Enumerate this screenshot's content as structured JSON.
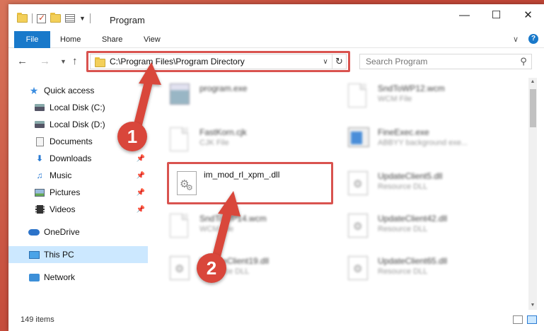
{
  "window": {
    "title": "Program",
    "controls": {
      "minimize": "—",
      "maximize": "☐",
      "close": "✕"
    }
  },
  "ribbon": {
    "tabs": [
      {
        "label": "File",
        "active": true
      },
      {
        "label": "Home"
      },
      {
        "label": "Share"
      },
      {
        "label": "View"
      }
    ],
    "expand": "∨",
    "help": "?"
  },
  "address": {
    "path": "C:\\Program Files\\Program Directory",
    "drop": "∨",
    "refresh": "↻"
  },
  "search": {
    "placeholder": "Search Program"
  },
  "sidebar": {
    "items": [
      {
        "label": "Quick access",
        "icon": "star-icon"
      },
      {
        "label": "Local Disk (C:)",
        "icon": "drive-icon"
      },
      {
        "label": "Local Disk (D:)",
        "icon": "drive-icon"
      },
      {
        "label": "Documents",
        "icon": "document-icon"
      },
      {
        "label": "Downloads",
        "icon": "download-icon",
        "pinned": true
      },
      {
        "label": "Music",
        "icon": "music-icon",
        "pinned": true
      },
      {
        "label": "Pictures",
        "icon": "pictures-icon",
        "pinned": true
      },
      {
        "label": "Videos",
        "icon": "video-icon",
        "pinned": true
      },
      {
        "label": "OneDrive",
        "icon": "cloud-icon"
      },
      {
        "label": "This PC",
        "icon": "computer-icon",
        "selected": true
      },
      {
        "label": "Network",
        "icon": "network-icon"
      }
    ]
  },
  "files": [
    {
      "name": "program.exe",
      "type": "",
      "icon": "exe-icon"
    },
    {
      "name": "SndToWP12.wcm",
      "type": "WCM File",
      "icon": "file-icon"
    },
    {
      "name": "FastKorn.cjk",
      "type": "CJK File",
      "icon": "file-icon"
    },
    {
      "name": "FineExec.exe",
      "type": "ABBYY background exe...",
      "icon": "app-icon"
    },
    {
      "name": "im_mod_rl_xpm_.dll",
      "type": "",
      "icon": "dll-icon"
    },
    {
      "name": "UpdateClient5.dll",
      "type": "Resource DLL",
      "icon": "dll-icon"
    },
    {
      "name": "SndToWP14.wcm",
      "type": "WCM File",
      "icon": "file-icon"
    },
    {
      "name": "UpdateClient42.dll",
      "type": "Resource DLL",
      "icon": "dll-icon"
    },
    {
      "name": "UpdateClient19.dll",
      "type": "Resource DLL",
      "icon": "dll-icon"
    },
    {
      "name": "UpdateClient65.dll",
      "type": "Resource DLL",
      "icon": "dll-icon"
    }
  ],
  "status": {
    "count": "149 items"
  },
  "annotations": {
    "step1": "1",
    "step2": "2",
    "color": "#d9463b"
  }
}
